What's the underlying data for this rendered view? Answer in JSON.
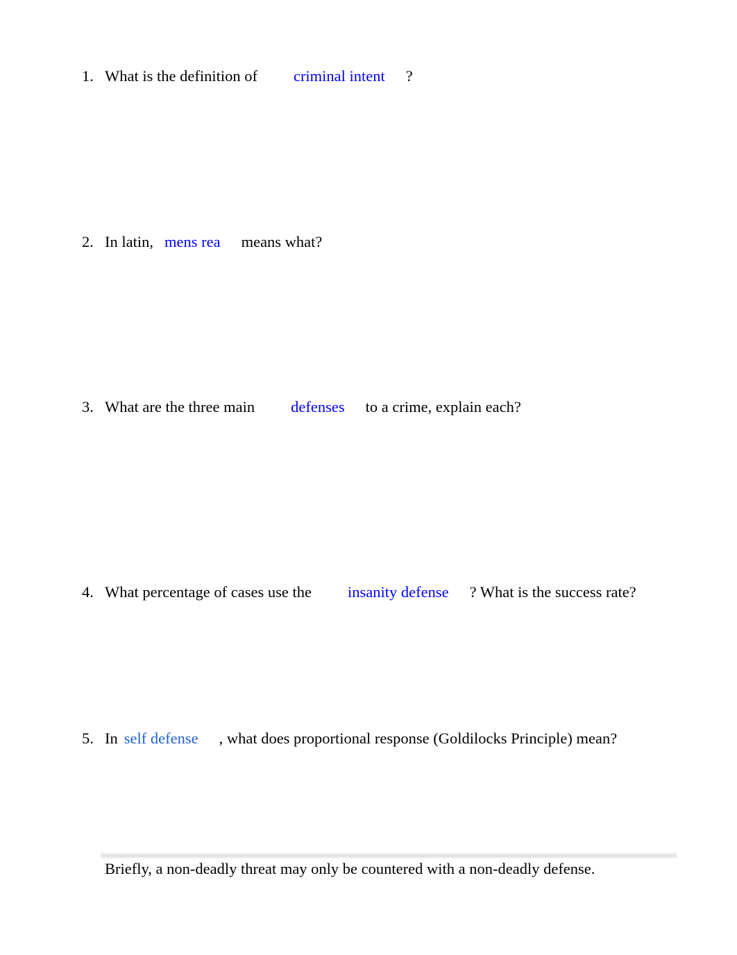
{
  "document": {
    "type": "worksheet",
    "text_color": "#000000",
    "term_color": "#0000ff",
    "term_color_soft": "#1f5fce",
    "background": "#ffffff"
  },
  "questions": [
    {
      "number": "1.",
      "before": "What is the definition of",
      "term": "criminal intent",
      "after": "?"
    },
    {
      "number": "2.",
      "before": "In latin,",
      "term": "mens rea",
      "after": "means what?"
    },
    {
      "number": "3.",
      "before": "What are the three main",
      "term": "defenses",
      "after": "to a crime, explain each?"
    },
    {
      "number": "4.",
      "before": "What percentage of cases use the",
      "term": "insanity defense",
      "after": "? What is the success rate?"
    },
    {
      "number": "5.",
      "before": "In",
      "term": "self defense",
      "after": ", what does proportional response (Goldilocks Principle) mean?"
    }
  ],
  "answer": {
    "text": "Briefly, a non-deadly threat may only be countered with a non-deadly defense."
  }
}
